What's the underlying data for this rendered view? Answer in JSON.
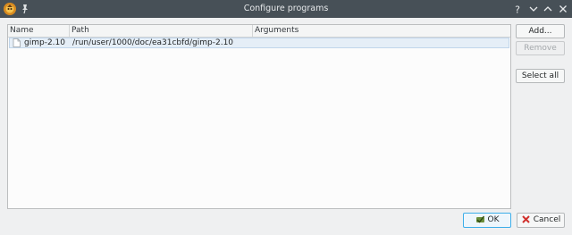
{
  "window": {
    "title": "Configure programs",
    "app_icon": "gimp-like-app-icon",
    "pin_icon": "pin-icon",
    "controls": [
      "help-icon",
      "minimize-icon",
      "maximize-icon",
      "close-icon"
    ],
    "controls_labels": {
      "help": "?"
    }
  },
  "table": {
    "columns": [
      "Name",
      "Path",
      "Arguments"
    ],
    "rows": [
      {
        "icon": "file-icon",
        "name": "gimp-2.10",
        "path": "/run/user/1000/doc/ea31cbfd/gimp-2.10",
        "arguments": ""
      }
    ],
    "selected_row_color": "#e5eef7"
  },
  "side_buttons": {
    "add": "Add...",
    "remove": "Remove",
    "select_all": "Select all"
  },
  "dialog_buttons": {
    "ok": "OK",
    "cancel": "Cancel"
  },
  "colors": {
    "titlebar": "#475057",
    "focus_accent": "#3daee9",
    "background": "#eff0f1"
  }
}
